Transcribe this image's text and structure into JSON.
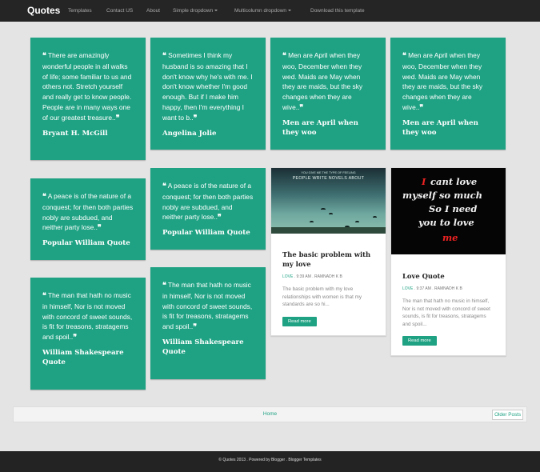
{
  "navbar": {
    "brand": "Quotes",
    "items": [
      {
        "label": "Templates"
      },
      {
        "label": "Contact US"
      },
      {
        "label": "About"
      },
      {
        "label": "Simple dropdown"
      },
      {
        "label": "Multicolumn dropdown"
      },
      {
        "label": "Download this template"
      }
    ]
  },
  "quote_cards": [
    {
      "quote": "There are amazingly wonderful people in all walks of life; some familiar to us and others not. Stretch yourself and really get to know people. People are in many ways one of our greatest treasure..",
      "author": "Bryant H. McGill"
    },
    {
      "quote": "Sometimes I think my husband is so amazing that I don't know why he's with me. I don't know whether I'm good enough. But if I make him happy, then I'm everything I want to b..",
      "author": "Angelina Jolie"
    },
    {
      "quote": "Men are April when they woo, December when they wed. Maids are May when they are maids, but the sky changes when they are wive..",
      "author": "Men are April when they woo"
    },
    {
      "quote": "Men are April when they woo, December when they wed. Maids are May when they are maids, but the sky changes when they are wive..",
      "author": "Men are April when they woo"
    },
    {
      "quote": "A peace is of the nature of a conquest; for then both parties nobly are subdued, and neither party lose..",
      "author": "Popular William Quote"
    },
    {
      "quote": "A peace is of the nature of a conquest; for then both parties nobly are subdued, and neither party lose..",
      "author": "Popular William Quote"
    },
    {
      "quote": "The man that hath no music in himself, Nor is not moved with concord of sweet sounds, is fit for treasons, stratagems and spoil..",
      "author": "William Shakespeare Quote"
    },
    {
      "quote": "The man that hath no music in himself, Nor is not moved with concord of sweet sounds, is fit for treasons, stratagems and spoil..",
      "author": "William Shakespeare Quote"
    }
  ],
  "image_posts": [
    {
      "title": "The basic problem with my love",
      "label": "LOVE",
      "time": "9:39 AM",
      "author": "RAMNADH K B",
      "excerpt": "The basic problem with my love relationships with women is that my standards are so hi...",
      "read_more": "Read more",
      "image_text": [
        "YOU GIVE ME THE TYPE OF FEELING",
        "PEOPLE WRITE NOVELS ABOUT"
      ]
    },
    {
      "title": "Love Quote",
      "label": "LOVE",
      "time": "9:37 AM",
      "author": "RAMNADH K B",
      "excerpt": "The man that hath no music in himself, Nor is not moved with concord of sweet sounds, is fit for treasons, stratagems and spoil...",
      "read_more": "Read more",
      "image_text": {
        "i": "I",
        "l1": "cant love",
        "l2": "myself so much",
        "l3": "So I need",
        "l4": "you to love",
        "me": "me"
      }
    }
  ],
  "pager": {
    "home": "Home",
    "older": "Older Posts"
  },
  "footer": {
    "copyright": "© Quotes 2013 . Powered by Blogger . Blogger Templates"
  },
  "colors": {
    "accent": "#1fa283",
    "navbar": "#252525",
    "background": "#e4e4e4"
  }
}
